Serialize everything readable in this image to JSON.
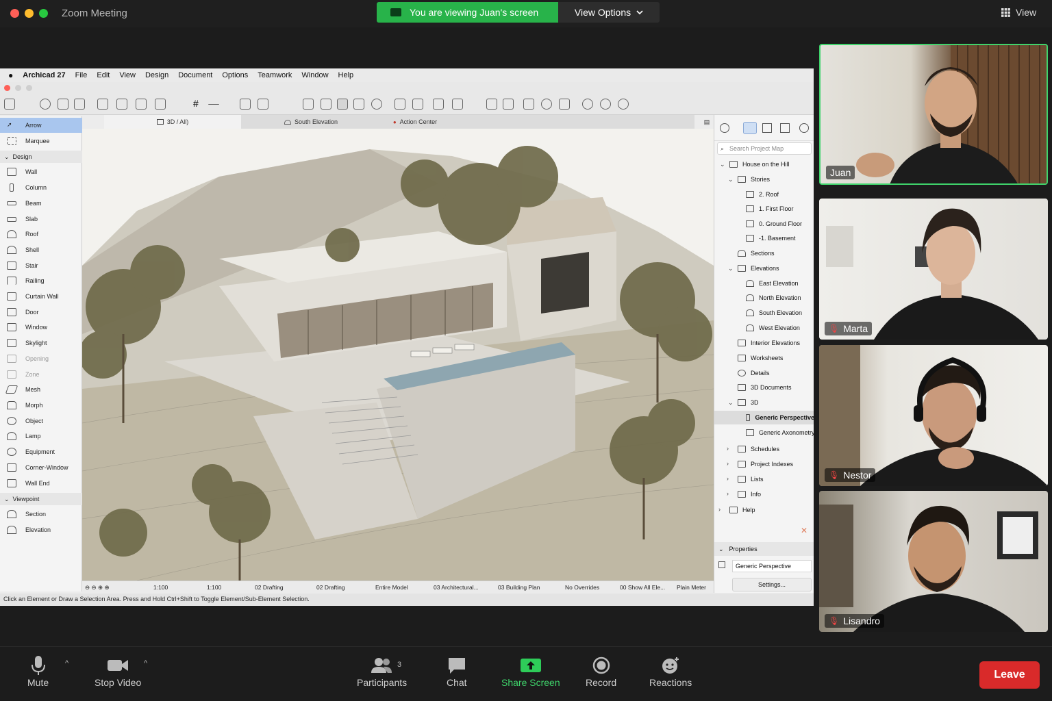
{
  "zoom": {
    "window_title": "Zoom Meeting",
    "share_banner": "You are viewing Juan's screen",
    "view_options": "View Options",
    "view": "View"
  },
  "archicad": {
    "menu": [
      "Archicad 27",
      "File",
      "Edit",
      "View",
      "Design",
      "Document",
      "Options",
      "Teamwork",
      "Window",
      "Help"
    ],
    "tabs": {
      "t1": "3D / All)",
      "t2": "South Elevation",
      "t3": "Action Center"
    },
    "toolbox": {
      "arrow": "Arrow",
      "marquee": "Marquee",
      "design_section": "Design",
      "wall": "Wall",
      "column": "Column",
      "beam": "Beam",
      "slab": "Slab",
      "roof": "Roof",
      "shell": "Shell",
      "stair": "Stair",
      "railing": "Railing",
      "curtain_wall": "Curtain Wall",
      "door": "Door",
      "window": "Window",
      "skylight": "Skylight",
      "opening": "Opening",
      "zone": "Zone",
      "mesh": "Mesh",
      "morph": "Morph",
      "object": "Object",
      "lamp": "Lamp",
      "equipment": "Equipment",
      "corner_window": "Corner-Window",
      "wall_end": "Wall End",
      "viewpoint_section": "Viewpoint",
      "section": "Section",
      "elevation": "Elevation"
    },
    "navigator": {
      "search_placeholder": "Search Project Map",
      "project": "House on the Hill",
      "stories": "Stories",
      "roof": "2. Roof",
      "first_floor": "1. First Floor",
      "ground_floor": "0. Ground Floor",
      "basement": "-1. Basement",
      "sections": "Sections",
      "elevations": "Elevations",
      "east": "East Elevation",
      "north": "North Elevation",
      "south": "South Elevation",
      "west": "West Elevation",
      "interior_elevations": "Interior Elevations",
      "worksheets": "Worksheets",
      "details": "Details",
      "documents_3d": "3D Documents",
      "three_d": "3D",
      "generic_perspective": "Generic Perspective",
      "generic_axonometry": "Generic Axonometry",
      "schedules": "Schedules",
      "project_indexes": "Project Indexes",
      "lists": "Lists",
      "info": "Info",
      "help": "Help",
      "properties": "Properties",
      "properties_value": "Generic Perspective",
      "settings": "Settings..."
    },
    "statusbar": {
      "scale1": "1:100",
      "scale2": "1:100",
      "layer1": "02 Drafting",
      "layer2": "02 Drafting",
      "model": "Entire Model",
      "arch": "03 Architectural...",
      "plan": "03 Building Plan",
      "overrides": "No Overrides",
      "show": "00 Show All Ele...",
      "meter": "Plain Meter"
    },
    "hint": "Click an Element or Draw a Selection Area. Press and Hold Ctrl+Shift to Toggle Element/Sub-Element Selection."
  },
  "participants": [
    {
      "name": "Juan",
      "muted": false
    },
    {
      "name": "Marta",
      "muted": true
    },
    {
      "name": "Nestor",
      "muted": true
    },
    {
      "name": "Lisandro",
      "muted": true
    }
  ],
  "controls": {
    "mute": "Mute",
    "stop_video": "Stop Video",
    "participants": "Participants",
    "participant_count": "3",
    "chat": "Chat",
    "share_screen": "Share Screen",
    "record": "Record",
    "reactions": "Reactions",
    "leave": "Leave"
  },
  "colors": {
    "accent_green": "#28b34a",
    "leave_red": "#d92a2a",
    "selection_blue": "#a9c6ee"
  }
}
